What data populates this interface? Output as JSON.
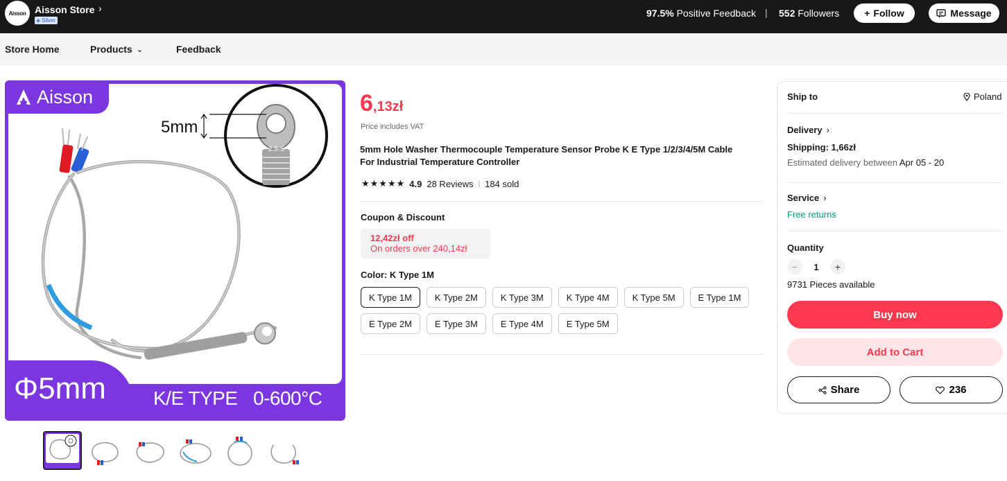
{
  "store": {
    "logo_text": "Aisson",
    "name": "Aisson Store",
    "badge": "Silver",
    "feedback_pct": "97.5%",
    "feedback_label": "Positive Feedback",
    "followers_count": "552",
    "followers_label": "Followers",
    "follow_label": "Follow",
    "message_label": "Message"
  },
  "nav": {
    "home": "Store Home",
    "products": "Products",
    "feedback": "Feedback"
  },
  "gallery": {
    "brand": "Aisson",
    "callout_size": "5mm",
    "ring_label": "2.5-5",
    "phi": "Φ5mm",
    "type": "K/E TYPE",
    "range": "0-600°C",
    "thumbnails": [
      "thumb-1",
      "thumb-2",
      "thumb-3",
      "thumb-4",
      "thumb-5",
      "thumb-6"
    ]
  },
  "product": {
    "price_int": "6",
    "price_dec": ",13zł",
    "vat_note": "Price includes VAT",
    "title": "5mm Hole Washer Thermocouple Temperature Sensor Probe K E Type 1/2/3/4/5M Cable For Industrial Temperature Controller",
    "rating": "4.9",
    "reviews": "28 Reviews",
    "sold": "184 sold",
    "star_count": 5
  },
  "coupon": {
    "heading": "Coupon & Discount",
    "off": "12,42zł off",
    "condition": "On orders over 240,14zł"
  },
  "color": {
    "heading": "Color: K Type 1M",
    "options": [
      "K Type 1M",
      "K Type 2M",
      "K Type 3M",
      "K Type 4M",
      "K Type 5M",
      "E Type 1M",
      "E Type 2M",
      "E Type 3M",
      "E Type 4M",
      "E Type 5M"
    ],
    "selected": "K Type 1M"
  },
  "panel": {
    "ship_to": "Ship to",
    "destination": "Poland",
    "delivery": "Delivery",
    "shipping": "Shipping: 1,66zł",
    "est_prefix": "Estimated delivery between",
    "est_dates": "Apr 05 - 20",
    "service": "Service",
    "free_returns": "Free returns",
    "quantity_label": "Quantity",
    "quantity": "1",
    "available": "9731 Pieces available",
    "buy_now": "Buy now",
    "add_to_cart": "Add to Cart",
    "share": "Share",
    "wishlist_count": "236"
  },
  "colors": {
    "accent": "#fd384f",
    "brand_purple": "#7b36e0",
    "topbar": "#181818",
    "success": "#00a06c"
  }
}
